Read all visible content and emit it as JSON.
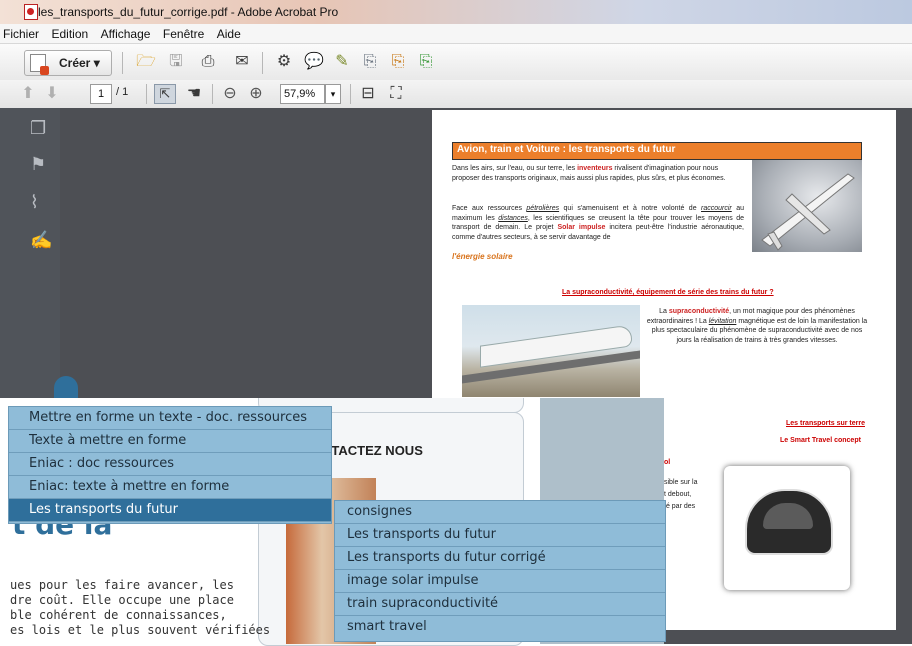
{
  "window": {
    "title": "les_transports_du_futur_corrige.pdf - Adobe Acrobat Pro"
  },
  "menubar": [
    "Fichier",
    "Edition",
    "Affichage",
    "Fenêtre",
    "Aide"
  ],
  "toolbar": {
    "create_label": "Créer ▾",
    "page_current": "1",
    "page_total": "/ 1",
    "zoom": "57,9%"
  },
  "pdf": {
    "header": "Avion, train et Voiture : les transports du futur",
    "para1_a": "Dans les airs, sur l'eau, ou sur terre, les ",
    "para1_b": "inventeurs",
    "para1_c": " rivalisent d'imagination pour nous proposer des transports originaux, mais aussi plus rapides, plus sûrs, et plus économes.",
    "para2_a": "Face aux ressources ",
    "para2_b": "pétrolières",
    "para2_c": " qui s'amenuisent et à notre volonté de ",
    "para2_d": "raccourcir",
    "para2_e": " au maximum les ",
    "para2_f": "distances",
    "para2_g": ", les scientifiques se creusent la tête pour trouver les moyens de transport de demain. Le projet ",
    "para2_h": "Solar impulse",
    "para2_i": " incitera peut-être l'industrie aéronautique, comme d'autres secteurs, à se servir davantage de",
    "solar": "l'énergie solaire",
    "section2_title": "La supraconductivité, équipement de série des trains du futur ?",
    "para3_a": "La ",
    "para3_b": "supraconductivité",
    "para3_c": ", un mot magique pour des phénomènes extraordinaires ! La ",
    "para3_d": "lévitation",
    "para3_e": " magnétique est de loin la manifestation la plus spectaculaire du phénomène de supraconductivité avec de nos jours la réalisation de trains à très grandes vitesses.",
    "section3_title": "Les transports sur terre",
    "section3_sub": "Le Smart Travel concept",
    "frag1": "ol",
    "frag2": "sible sur la",
    "frag3": "t   debout,",
    "frag4": "té par des"
  },
  "web": {
    "contact": "NTACTEZ NOUS",
    "big_title": "t de la",
    "body_lines": [
      "ues pour les faire avancer, les",
      "dre coût. Elle occupe une place",
      "ble cohérent de connaissances,",
      "es lois et le plus souvent vérifiées"
    ]
  },
  "menu1": {
    "items": [
      "Mettre en forme un texte - doc. ressources",
      "Texte à mettre en forme",
      "Eniac : doc ressources",
      "Eniac: texte à mettre en forme",
      "Les transports du futur"
    ],
    "selected_index": 4
  },
  "menu2": {
    "items": [
      "consignes",
      "Les transports du futur",
      "Les transports du futur corrigé",
      "image solar impulse",
      "train supraconductivité",
      "smart travel"
    ]
  },
  "colors": {
    "accent_orange": "#ec7f2b",
    "menu_bg": "#8fbcd8",
    "menu_selected": "#2f6f9b",
    "red_text": "#c22222"
  },
  "icons": [
    "pdf-icon",
    "open-folder-icon",
    "save-icon",
    "print-icon",
    "email-icon",
    "settings-icon",
    "comment-icon",
    "sign-icon",
    "export-icon",
    "share-icon",
    "up-arrow-icon",
    "down-arrow-icon",
    "select-tool-icon",
    "hand-tool-icon",
    "zoom-out-icon",
    "zoom-in-icon",
    "fit-page-icon",
    "full-screen-icon",
    "pages-panel-icon",
    "bookmarks-panel-icon",
    "attachments-panel-icon",
    "signatures-panel-icon"
  ]
}
